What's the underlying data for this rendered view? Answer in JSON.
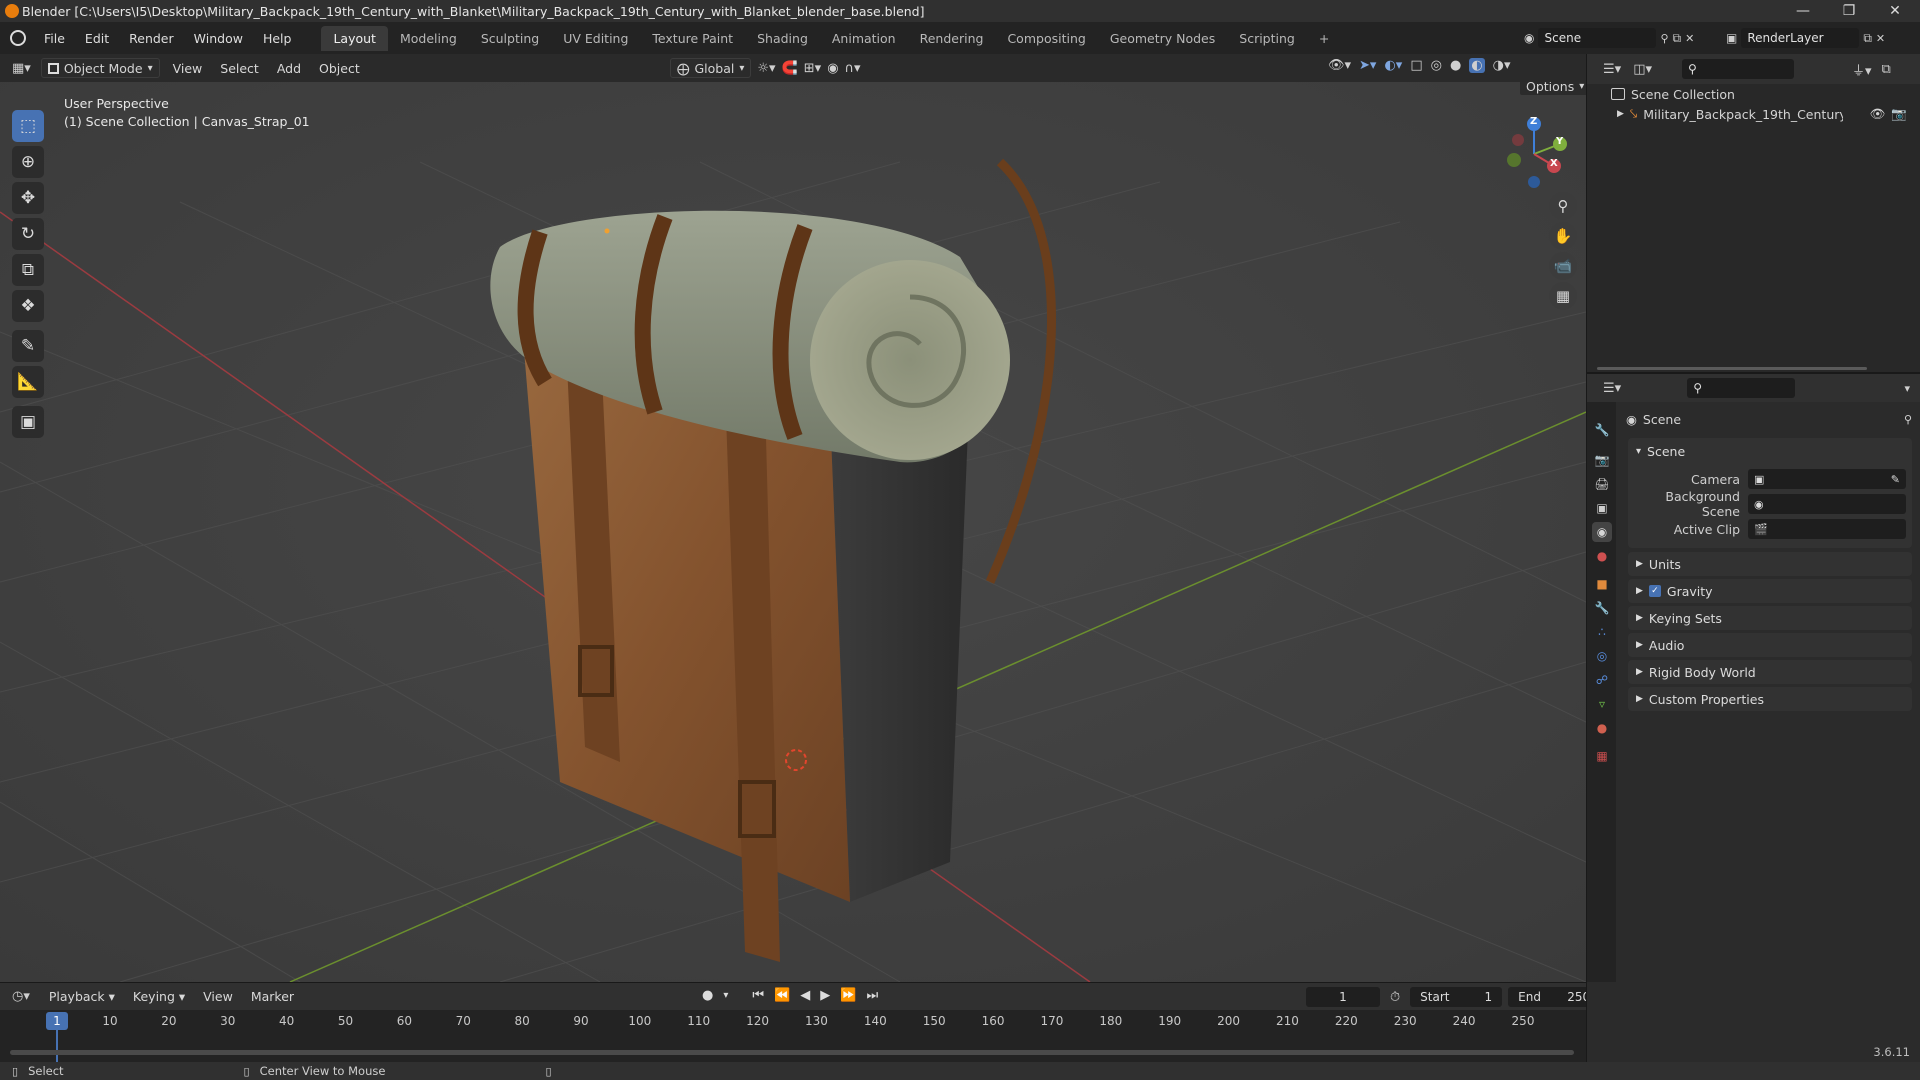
{
  "app": {
    "title": "Blender [C:\\Users\\I5\\Desktop\\Military_Backpack_19th_Century_with_Blanket\\Military_Backpack_19th_Century_with_Blanket_blender_base.blend]",
    "version": "3.6.11"
  },
  "menu": [
    "File",
    "Edit",
    "Render",
    "Window",
    "Help"
  ],
  "workspaces": [
    "Layout",
    "Modeling",
    "Sculpting",
    "UV Editing",
    "Texture Paint",
    "Shading",
    "Animation",
    "Rendering",
    "Compositing",
    "Geometry Nodes",
    "Scripting"
  ],
  "active_workspace": "Layout",
  "scene_selector": "Scene",
  "view_layer_selector": "RenderLayer",
  "viewport": {
    "mode": "Object Mode",
    "header_menus": [
      "View",
      "Select",
      "Add",
      "Object"
    ],
    "orientation": "Global",
    "options_label": "Options",
    "overlay_line1": "User Perspective",
    "overlay_line2": "(1) Scene Collection | Canvas_Strap_01",
    "gizmo_axes": {
      "z": "Z",
      "y": "Y",
      "x": "X"
    }
  },
  "outliner": {
    "root": "Scene Collection",
    "items": [
      "Military_Backpack_19th_Century_with_"
    ]
  },
  "properties": {
    "context_title": "Scene",
    "panel_title": "Scene",
    "fields": [
      {
        "label": "Camera",
        "value": ""
      },
      {
        "label": "Background Scene",
        "value": ""
      },
      {
        "label": "Active Clip",
        "value": ""
      }
    ],
    "collapsed_panels": [
      "Units",
      "Gravity",
      "Keying Sets",
      "Audio",
      "Rigid Body World",
      "Custom Properties"
    ],
    "gravity_checked": true
  },
  "timeline": {
    "menus": [
      "Playback",
      "Keying",
      "View",
      "Marker"
    ],
    "current_frame": "1",
    "start_label": "Start",
    "start": "1",
    "end_label": "End",
    "end": "250",
    "ticks": [
      "1",
      "10",
      "20",
      "30",
      "40",
      "50",
      "60",
      "70",
      "80",
      "90",
      "100",
      "110",
      "120",
      "130",
      "140",
      "150",
      "160",
      "170",
      "180",
      "190",
      "200",
      "210",
      "220",
      "230",
      "240",
      "250"
    ]
  },
  "statusbar": {
    "left_action": "Select",
    "middle_action": "Center View to Mouse"
  },
  "colors": {
    "accent": "#4772b3",
    "x_axis": "#c8474f",
    "y_axis": "#7fae3d",
    "z_axis": "#3f7fd8",
    "leather": "#8a5a34",
    "blanket": "#8f9684"
  }
}
